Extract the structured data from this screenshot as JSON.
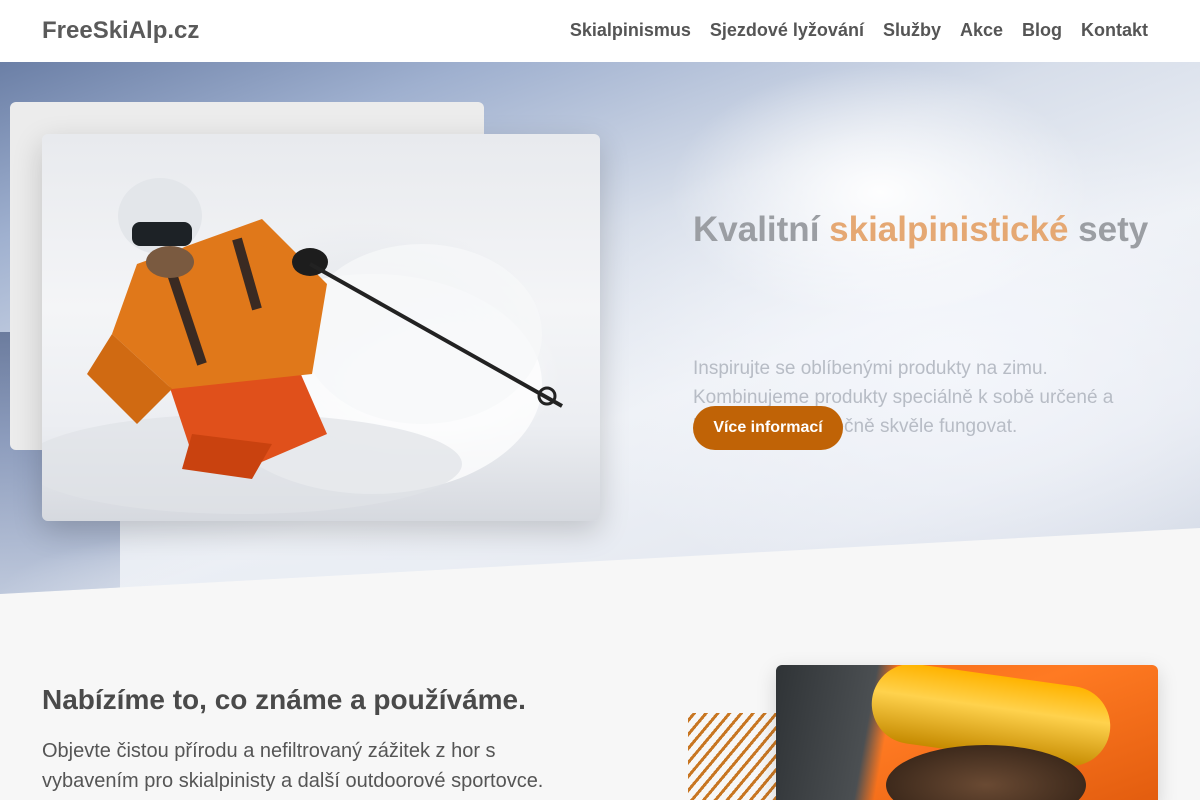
{
  "header": {
    "brand": "FreeSkiAlp.cz",
    "nav": [
      "Skialpinismus",
      "Sjezdové lyžování",
      "Služby",
      "Akce",
      "Blog",
      "Kontakt"
    ]
  },
  "hero": {
    "title_part1": "Kvalitní ",
    "title_accent": "skialpinistické",
    "title_part2": " sety",
    "text": "Inspirujte se oblíbenými produkty na zimu. Kombinujeme produkty speciálně k sobě určené a které budou společně skvěle fungovat.",
    "cta_label": "Více informací"
  },
  "section": {
    "title": "Nabízíme to, co známe a používáme.",
    "text": "Objevte čistou přírodu a nefiltrovaný zážitek z hor s vybavením pro skialpinisty a další outdoorové sportovce."
  },
  "colors": {
    "accent": "#c06306",
    "title_accent": "#e5a873",
    "stripes": "#c87622"
  },
  "icons": [
    "skier-photo",
    "goggles-photo"
  ]
}
